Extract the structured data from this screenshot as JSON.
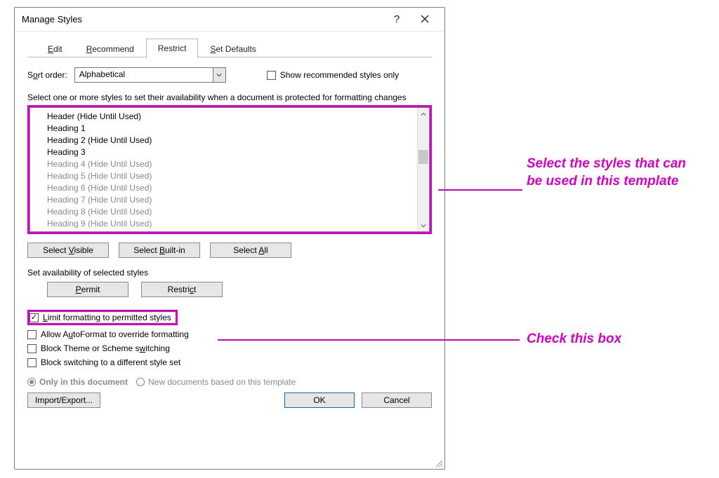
{
  "title": "Manage Styles",
  "tabs": {
    "edit": "Edit",
    "recommend": "Recommend",
    "restrict": "Restrict",
    "set_defaults": "Set Defaults"
  },
  "sort_label_pre": "S",
  "sort_label_u": "o",
  "sort_label_post": "rt order:",
  "sort_value": "Alphabetical",
  "show_recommended": "Show recommended styles only",
  "desc": "Select one or more styles to set their availability when a document is protected for formatting changes",
  "styles": [
    {
      "label": "Header  (Hide Until Used)",
      "dim": false
    },
    {
      "label": "Heading 1",
      "dim": false
    },
    {
      "label": "Heading 2  (Hide Until Used)",
      "dim": false
    },
    {
      "label": "Heading 3",
      "dim": false
    },
    {
      "label": "Heading 4  (Hide Until Used)",
      "dim": true
    },
    {
      "label": "Heading 5  (Hide Until Used)",
      "dim": true
    },
    {
      "label": "Heading 6  (Hide Until Used)",
      "dim": true
    },
    {
      "label": "Heading 7  (Hide Until Used)",
      "dim": true
    },
    {
      "label": "Heading 8  (Hide Until Used)",
      "dim": true
    },
    {
      "label": "Heading 9  (Hide Until Used)",
      "dim": true
    }
  ],
  "btn_visible_pre": "Select ",
  "btn_visible_u": "V",
  "btn_visible_post": "isible",
  "btn_builtin_pre": "Select ",
  "btn_builtin_u": "B",
  "btn_builtin_post": "uilt-in",
  "btn_all_pre": "Select ",
  "btn_all_u": "A",
  "btn_all_post": "ll",
  "set_avail": "Set availability of selected styles",
  "btn_permit_u": "P",
  "btn_permit_post": "ermit",
  "btn_restrict_pre": "Restri",
  "btn_restrict_u": "c",
  "btn_restrict_post": "t",
  "cb_limit_u": "L",
  "cb_limit_post": "imit formatting to permitted styles",
  "cb_auto_pre": "Allow A",
  "cb_auto_u": "u",
  "cb_auto_post": "toFormat to override formatting",
  "cb_theme_pre": "Block Theme or Scheme s",
  "cb_theme_u": "w",
  "cb_theme_post": "itching",
  "cb_set_pre": "Block switching to a different style set",
  "radio_doc": "Only in this document",
  "radio_tpl": "New documents based on this template",
  "btn_import": "Import/Export...",
  "btn_ok": "OK",
  "btn_cancel": "Cancel",
  "anno1": "Select the styles that can be used in this template",
  "anno2": "Check this box"
}
